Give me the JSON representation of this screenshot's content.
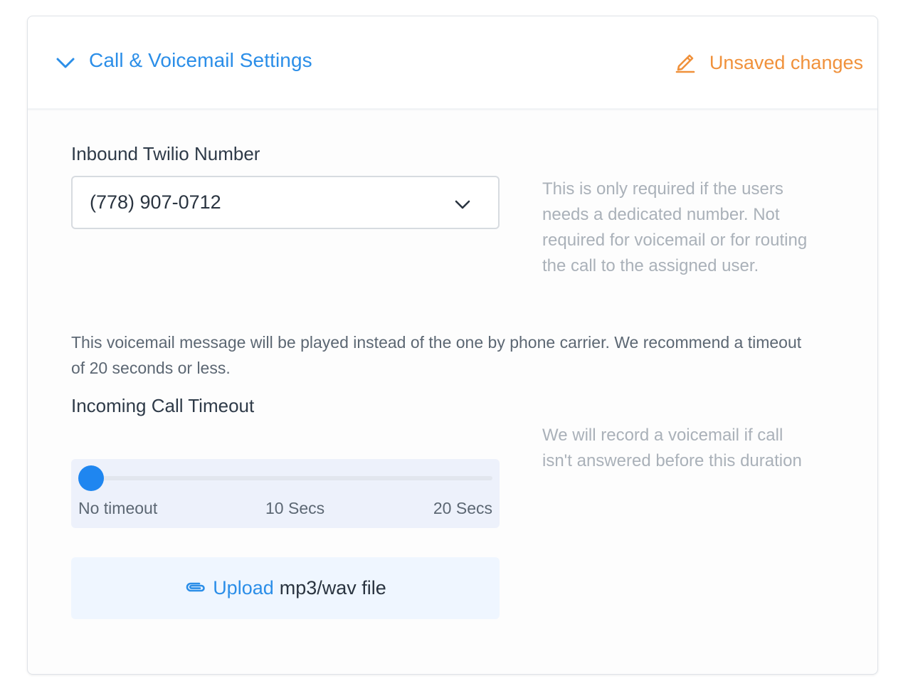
{
  "header": {
    "title": "Call & Voicemail Settings",
    "collapse_icon": "chevron-down-icon",
    "status_icon": "pencil-icon",
    "status_label": "Unsaved changes",
    "accent_color": "#2b8ee8",
    "status_color": "#f0913b"
  },
  "twilio": {
    "label": "Inbound Twilio Number",
    "selected_value": "(778) 907-0712",
    "help_lines": [
      "This is only required if the users",
      "needs a dedicated number. Not",
      "required for voicemail or for routing",
      "the call to the assigned user."
    ]
  },
  "voicemail": {
    "info_text": "This voicemail message will be played instead of the one by phone carrier. We recommend a timeout of 20 seconds or less."
  },
  "timeout": {
    "label": "Incoming Call Timeout",
    "help_lines": [
      "We will record a voicemail if call",
      "isn't answered before this duration"
    ],
    "slider": {
      "min_seconds": 0,
      "max_seconds": 20,
      "value_seconds": 0,
      "tick_labels": [
        "No timeout",
        "10 Secs",
        "20 Secs"
      ]
    }
  },
  "upload": {
    "icon": "paperclip-icon",
    "link_label": "Upload",
    "rest_label": "mp3/wav file"
  }
}
